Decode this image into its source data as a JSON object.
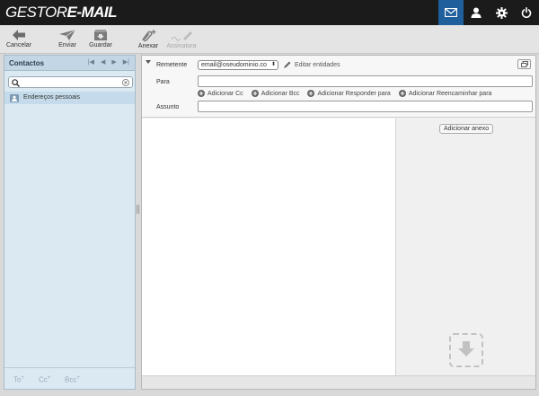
{
  "app": {
    "logo_part1": "GESTOR",
    "logo_part2": "E-MAIL"
  },
  "topbar": {
    "icons": [
      "mail-icon",
      "user-icon",
      "gear-icon",
      "power-icon"
    ]
  },
  "toolbar": {
    "cancel_label": "Cancelar",
    "send_label": "Enviar",
    "save_label": "Guardar",
    "attach_label": "Anexar",
    "signature_label": "Assinatura"
  },
  "contacts": {
    "title": "Contactos",
    "pager": [
      "|◀",
      "◀",
      "▶",
      "▶|"
    ],
    "search_value": "",
    "address_book_label": "Endereços pessoais",
    "footer": {
      "to": "To",
      "cc": "Cc",
      "bcc": "Bcc"
    }
  },
  "compose": {
    "sender_label": "Remetente",
    "sender_value": "email@oseudominio.co",
    "edit_entities": "Editar entidades",
    "to_label": "Para",
    "subject_label": "Assunto",
    "add_cc": "Adicionar Cc",
    "add_bcc": "Adicionar Bcc",
    "add_reply_to": "Adicionar Responder para",
    "add_forward_to": "Adicionar Reencaminhar para",
    "add_attachment": "Adicionar anexo"
  },
  "colors": {
    "topbar": "#1b1b1b",
    "active_icon": "#1f5f9c",
    "contacts_bg": "#dbe9f3"
  }
}
